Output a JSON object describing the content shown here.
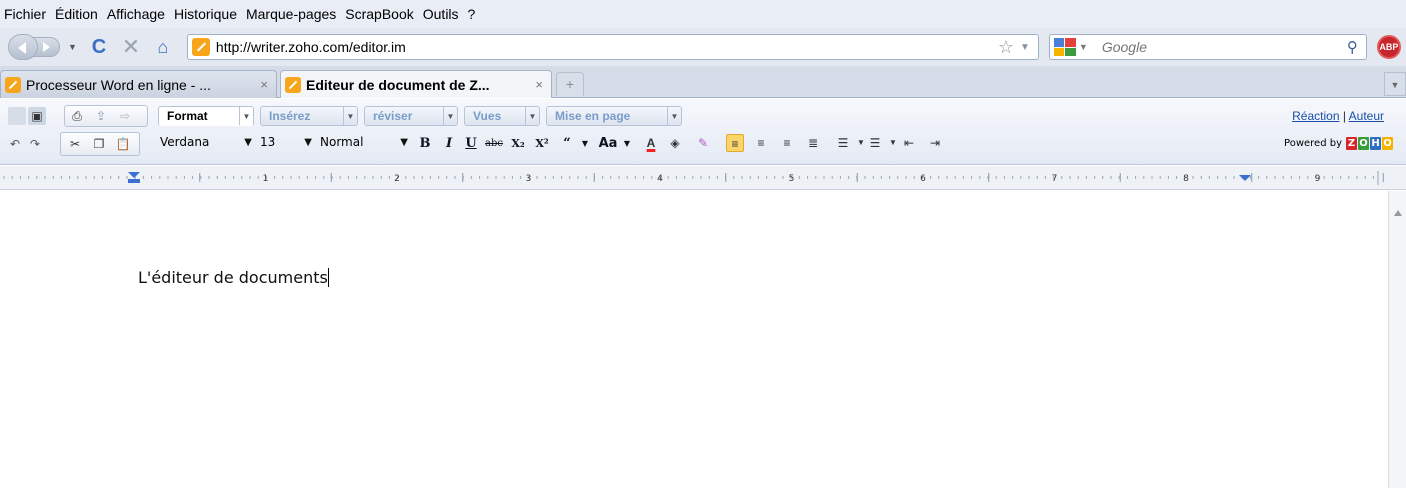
{
  "menubar": {
    "items": [
      "Fichier",
      "Édition",
      "Affichage",
      "Historique",
      "Marque-pages",
      "ScrapBook",
      "Outils",
      "?"
    ]
  },
  "navbar": {
    "url": "http://writer.zoho.com/editor.im",
    "search_placeholder": "Google",
    "adblock_label": "ABP"
  },
  "tabs": [
    {
      "label": "Processeur Word en ligne - ...",
      "active": false
    },
    {
      "label": "Editeur de document de Z...",
      "active": true
    }
  ],
  "tab_close_glyph": "×",
  "new_tab_glyph": "+",
  "editor": {
    "menu_tabs": [
      "Format",
      "Insérez",
      "réviser",
      "Vues",
      "Mise en page"
    ],
    "active_menu_tab": "Format",
    "top_links": [
      "Réaction",
      "Auteur"
    ],
    "font_family": "Verdana",
    "font_size": "13",
    "style": "Normal",
    "format_buttons": [
      "B",
      "I",
      "U",
      "abc",
      "X₂",
      "X²",
      "“",
      "Aa"
    ],
    "powered_by": "Powered by",
    "brand_letters": [
      "Z",
      "O",
      "H",
      "O"
    ],
    "brand_colors": [
      "#d6262b",
      "#3a9c3a",
      "#2c6fc0",
      "#f5b400"
    ]
  },
  "ruler": {
    "numbers": [
      "1",
      "2",
      "3",
      "4",
      "5",
      "6",
      "7",
      "8",
      "9"
    ]
  },
  "document": {
    "text": "L'éditeur de documents"
  }
}
